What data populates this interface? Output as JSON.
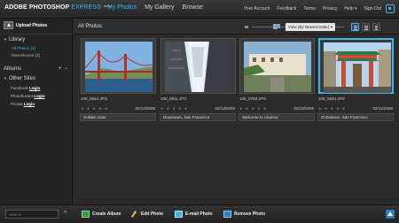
{
  "header": {
    "brand_main": "ADOBE",
    "brand_product": "PHOTOSHOP",
    "brand_sub": "EXPRESS",
    "brand_beta": "BETA",
    "nav": [
      "My Photos",
      "My Gallery",
      "Browse"
    ],
    "active_nav": "My Photos",
    "user_links": [
      "Your Account",
      "Feedback",
      "Terms",
      "Privacy",
      "Help ▾",
      "Sign Out"
    ]
  },
  "sidebar": {
    "upload_label": "Upload Photos",
    "library_label": "Library",
    "library_items": [
      "All Photos (4)",
      "Most Recent (3)"
    ],
    "albums_label": "Albums",
    "albums_add": "+",
    "albums_remove": "−",
    "other_sites_label": "Other Sites",
    "other_sites": [
      {
        "name": "Facebook",
        "action": "Login"
      },
      {
        "name": "Photobucket",
        "action": "Login"
      },
      {
        "name": "Picasa",
        "action": "Login"
      }
    ]
  },
  "toolbar": {
    "title": "All Photos",
    "sort_value": "View (By Newest Date)"
  },
  "photos": [
    {
      "file": "100_0844.JPG",
      "date": "02/13/2006",
      "caption": "Golden Gate",
      "stars": "★ ★ ★ ★ ★"
    },
    {
      "file": "100_0811.JPG",
      "date": "02/13/2006",
      "caption": "Downtown, San Francisco",
      "stars": "★ ★ ★ ★ ★"
    },
    {
      "file": "100_0783.JPG",
      "date": "02/13/2006",
      "caption": "Welcome to Alcatraz",
      "stars": "★ ★ ★ ★ ★"
    },
    {
      "file": "100_0643.JPG",
      "date": "02/12/2006",
      "caption": "Chinatown, San Francisco",
      "stars": "★ ★ ★ ★ ★"
    }
  ],
  "bottombar": {
    "search_placeholder": "Search",
    "actions": [
      "Create Album",
      "Edit Photo",
      "E-mail Photo",
      "Remove Photo"
    ]
  },
  "colors": {
    "accent": "#3ab8ee",
    "background": "#2b2b2b"
  },
  "icons": [
    "corner-app-icon",
    "upload-icon",
    "zoom-small-icon",
    "zoom-large-icon",
    "grid-view-icon",
    "list-view-icon",
    "detail-view-icon",
    "album-icon",
    "edit-icon",
    "email-icon",
    "remove-icon",
    "scroll-up-icon"
  ]
}
